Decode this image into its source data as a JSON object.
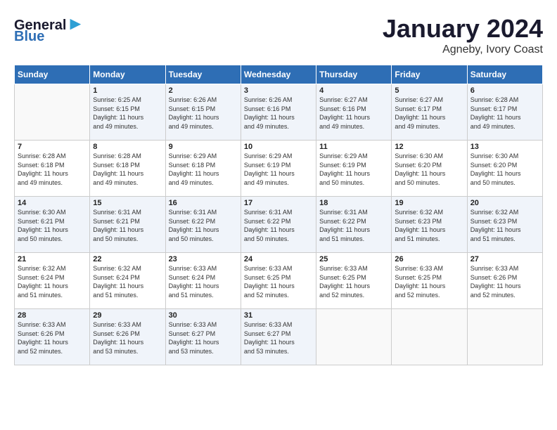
{
  "logo": {
    "line1": "General",
    "line2": "Blue"
  },
  "title": "January 2024",
  "subtitle": "Agneby, Ivory Coast",
  "days_of_week": [
    "Sunday",
    "Monday",
    "Tuesday",
    "Wednesday",
    "Thursday",
    "Friday",
    "Saturday"
  ],
  "weeks": [
    [
      {
        "num": "",
        "info": ""
      },
      {
        "num": "1",
        "info": "Sunrise: 6:25 AM\nSunset: 6:15 PM\nDaylight: 11 hours\nand 49 minutes."
      },
      {
        "num": "2",
        "info": "Sunrise: 6:26 AM\nSunset: 6:15 PM\nDaylight: 11 hours\nand 49 minutes."
      },
      {
        "num": "3",
        "info": "Sunrise: 6:26 AM\nSunset: 6:16 PM\nDaylight: 11 hours\nand 49 minutes."
      },
      {
        "num": "4",
        "info": "Sunrise: 6:27 AM\nSunset: 6:16 PM\nDaylight: 11 hours\nand 49 minutes."
      },
      {
        "num": "5",
        "info": "Sunrise: 6:27 AM\nSunset: 6:17 PM\nDaylight: 11 hours\nand 49 minutes."
      },
      {
        "num": "6",
        "info": "Sunrise: 6:28 AM\nSunset: 6:17 PM\nDaylight: 11 hours\nand 49 minutes."
      }
    ],
    [
      {
        "num": "7",
        "info": "Sunrise: 6:28 AM\nSunset: 6:18 PM\nDaylight: 11 hours\nand 49 minutes."
      },
      {
        "num": "8",
        "info": "Sunrise: 6:28 AM\nSunset: 6:18 PM\nDaylight: 11 hours\nand 49 minutes."
      },
      {
        "num": "9",
        "info": "Sunrise: 6:29 AM\nSunset: 6:18 PM\nDaylight: 11 hours\nand 49 minutes."
      },
      {
        "num": "10",
        "info": "Sunrise: 6:29 AM\nSunset: 6:19 PM\nDaylight: 11 hours\nand 49 minutes."
      },
      {
        "num": "11",
        "info": "Sunrise: 6:29 AM\nSunset: 6:19 PM\nDaylight: 11 hours\nand 50 minutes."
      },
      {
        "num": "12",
        "info": "Sunrise: 6:30 AM\nSunset: 6:20 PM\nDaylight: 11 hours\nand 50 minutes."
      },
      {
        "num": "13",
        "info": "Sunrise: 6:30 AM\nSunset: 6:20 PM\nDaylight: 11 hours\nand 50 minutes."
      }
    ],
    [
      {
        "num": "14",
        "info": "Sunrise: 6:30 AM\nSunset: 6:21 PM\nDaylight: 11 hours\nand 50 minutes."
      },
      {
        "num": "15",
        "info": "Sunrise: 6:31 AM\nSunset: 6:21 PM\nDaylight: 11 hours\nand 50 minutes."
      },
      {
        "num": "16",
        "info": "Sunrise: 6:31 AM\nSunset: 6:22 PM\nDaylight: 11 hours\nand 50 minutes."
      },
      {
        "num": "17",
        "info": "Sunrise: 6:31 AM\nSunset: 6:22 PM\nDaylight: 11 hours\nand 50 minutes."
      },
      {
        "num": "18",
        "info": "Sunrise: 6:31 AM\nSunset: 6:22 PM\nDaylight: 11 hours\nand 51 minutes."
      },
      {
        "num": "19",
        "info": "Sunrise: 6:32 AM\nSunset: 6:23 PM\nDaylight: 11 hours\nand 51 minutes."
      },
      {
        "num": "20",
        "info": "Sunrise: 6:32 AM\nSunset: 6:23 PM\nDaylight: 11 hours\nand 51 minutes."
      }
    ],
    [
      {
        "num": "21",
        "info": "Sunrise: 6:32 AM\nSunset: 6:24 PM\nDaylight: 11 hours\nand 51 minutes."
      },
      {
        "num": "22",
        "info": "Sunrise: 6:32 AM\nSunset: 6:24 PM\nDaylight: 11 hours\nand 51 minutes."
      },
      {
        "num": "23",
        "info": "Sunrise: 6:33 AM\nSunset: 6:24 PM\nDaylight: 11 hours\nand 51 minutes."
      },
      {
        "num": "24",
        "info": "Sunrise: 6:33 AM\nSunset: 6:25 PM\nDaylight: 11 hours\nand 52 minutes."
      },
      {
        "num": "25",
        "info": "Sunrise: 6:33 AM\nSunset: 6:25 PM\nDaylight: 11 hours\nand 52 minutes."
      },
      {
        "num": "26",
        "info": "Sunrise: 6:33 AM\nSunset: 6:25 PM\nDaylight: 11 hours\nand 52 minutes."
      },
      {
        "num": "27",
        "info": "Sunrise: 6:33 AM\nSunset: 6:26 PM\nDaylight: 11 hours\nand 52 minutes."
      }
    ],
    [
      {
        "num": "28",
        "info": "Sunrise: 6:33 AM\nSunset: 6:26 PM\nDaylight: 11 hours\nand 52 minutes."
      },
      {
        "num": "29",
        "info": "Sunrise: 6:33 AM\nSunset: 6:26 PM\nDaylight: 11 hours\nand 53 minutes."
      },
      {
        "num": "30",
        "info": "Sunrise: 6:33 AM\nSunset: 6:27 PM\nDaylight: 11 hours\nand 53 minutes."
      },
      {
        "num": "31",
        "info": "Sunrise: 6:33 AM\nSunset: 6:27 PM\nDaylight: 11 hours\nand 53 minutes."
      },
      {
        "num": "",
        "info": ""
      },
      {
        "num": "",
        "info": ""
      },
      {
        "num": "",
        "info": ""
      }
    ]
  ]
}
